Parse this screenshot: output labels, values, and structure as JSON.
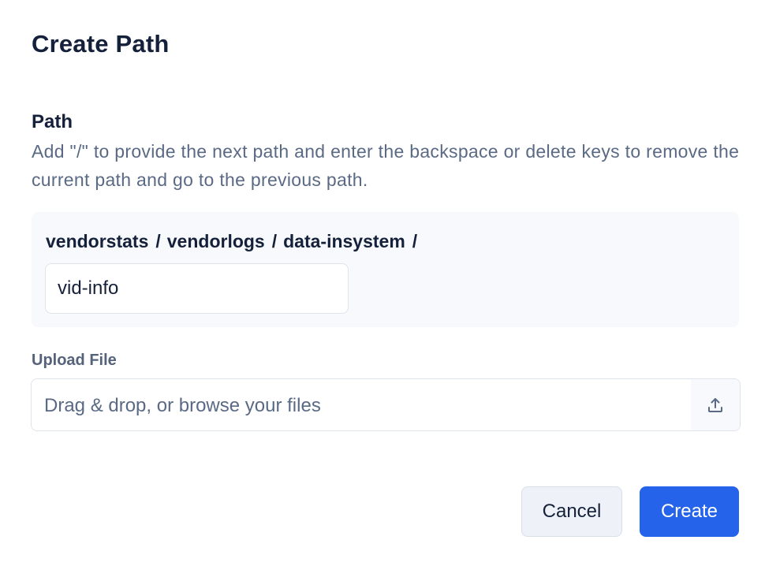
{
  "dialog": {
    "title": "Create Path"
  },
  "path_field": {
    "label": "Path",
    "help": "Add \"/\" to provide the next path and enter the backspace or delete keys to remove the current path and go to the previous path.",
    "segments": [
      "vendorstats",
      "vendorlogs",
      "data-insystem"
    ],
    "separator": "/",
    "input_value": "vid-info"
  },
  "upload": {
    "label": "Upload File",
    "placeholder": "Drag & drop, or browse your files",
    "icon": "upload-icon"
  },
  "actions": {
    "cancel_label": "Cancel",
    "create_label": "Create"
  },
  "colors": {
    "primary": "#2563eb",
    "text_dark": "#15213a",
    "text_muted": "#5a6a85",
    "panel_bg": "#f7f9fc"
  }
}
